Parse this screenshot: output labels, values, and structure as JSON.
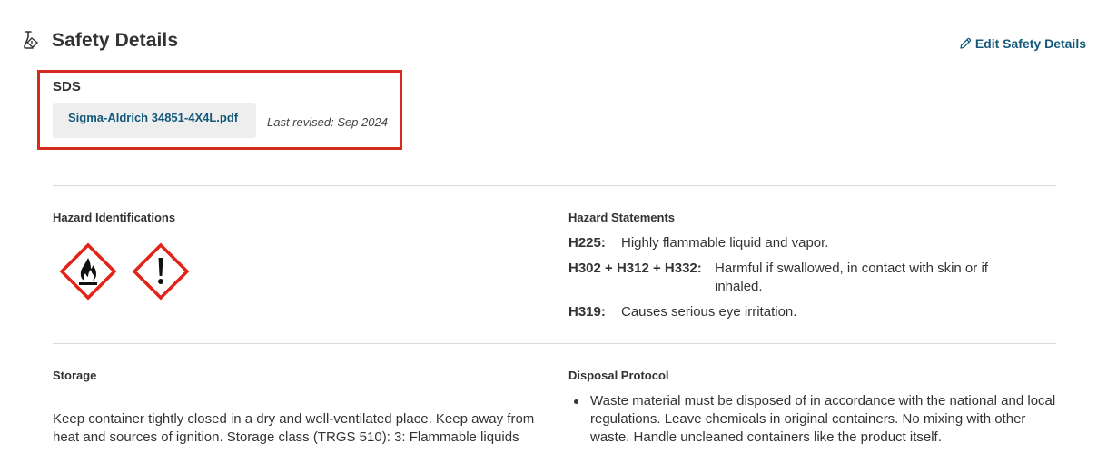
{
  "header": {
    "title": "Safety Details",
    "edit_label": "Edit Safety Details",
    "icon": "flask-hazard-icon"
  },
  "sds": {
    "label": "SDS",
    "file_name": "Sigma-Aldrich 34851-4X4L.pdf",
    "last_revised": "Last revised: Sep 2024"
  },
  "hazard_identifications": {
    "label": "Hazard Identifications",
    "pictograms": [
      "flame-pictogram-icon",
      "exclamation-pictogram-icon"
    ]
  },
  "hazard_statements": {
    "label": "Hazard Statements",
    "items": [
      {
        "code": "H225:",
        "text": "Highly flammable liquid and vapor."
      },
      {
        "code": "H302 + H312 + H332:",
        "text": "Harmful if swallowed, in contact with skin or if inhaled."
      },
      {
        "code": "H319:",
        "text": "Causes serious eye irritation."
      }
    ]
  },
  "storage": {
    "label": "Storage",
    "text": "Keep container tightly closed in a dry and well-ventilated place. Keep away from heat and sources of ignition. Storage class (TRGS 510): 3: Flammable liquids"
  },
  "disposal": {
    "label": "Disposal Protocol",
    "items": [
      "Waste material must be disposed of in accordance with the national and local regulations. Leave chemicals in original containers. No mixing with other waste. Handle uncleaned containers like the product itself."
    ]
  },
  "colors": {
    "link": "#14587a",
    "highlight": "#d42b1e",
    "ghs_red": "#e2231a"
  }
}
